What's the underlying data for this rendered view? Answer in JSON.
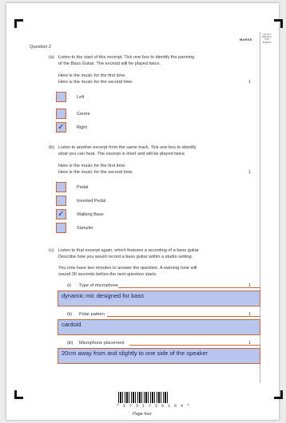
{
  "header": {
    "marks": "MARKS",
    "do_not_write": "DO NOT WRITE IN THIS MARGIN"
  },
  "question": {
    "title": "Question 2",
    "a": {
      "label": "(a)",
      "line1": "Listen to the start of this excerpt.  Tick one box to identify the panning",
      "line2": "of the Bass Guitar.  The excerpt will be played twice.",
      "music1": "Here is the music for the first time.",
      "music2": "Here is the music for the second time.",
      "mark": "1",
      "options": [
        {
          "label": "Left",
          "tick": ""
        },
        {
          "label": "Centre",
          "tick": ""
        },
        {
          "label": "Right",
          "tick": "✓"
        }
      ]
    },
    "b": {
      "label": "(b)",
      "line1": "Listen to another excerpt from the same track.  Tick one box to identify",
      "line2": "what you can hear.  The excerpt is short and will be played twice.",
      "music1": "Here is the music for the first time.",
      "music2": "Here is the music for the second time.",
      "mark": "1",
      "options": [
        {
          "label": "Pedal",
          "tick": ""
        },
        {
          "label": "Inverted Pedal",
          "tick": ""
        },
        {
          "label": "Walking Bass",
          "tick": "✓"
        },
        {
          "label": "Sampler",
          "tick": ""
        }
      ]
    },
    "c": {
      "label": "(c)",
      "line1": "Listen to that excerpt again, which features a recording of a bass guitar.",
      "line2": "Describe how you would record a bass guitar within a studio setting.",
      "line3": "You now have two minutes to answer the question.  A warning tone will",
      "line4": "sound 30 seconds before the next question starts.",
      "parts": [
        {
          "label": "(i)",
          "prompt": "Type of microphone",
          "answer": "dynamic mic designed for bass",
          "mark": "1"
        },
        {
          "label": "(ii)",
          "prompt": "Polar pattern",
          "answer": "cardoid",
          "mark": "1"
        },
        {
          "label": "(iii)",
          "prompt": "Microphone placement",
          "answer": "20cm away from and slightly to one side of the speaker",
          "mark": "1"
        }
      ]
    }
  },
  "footer": {
    "barcode_number": "* X 7 5 1 7 5 0 1 0 4 *",
    "page_label": "Page four"
  }
}
